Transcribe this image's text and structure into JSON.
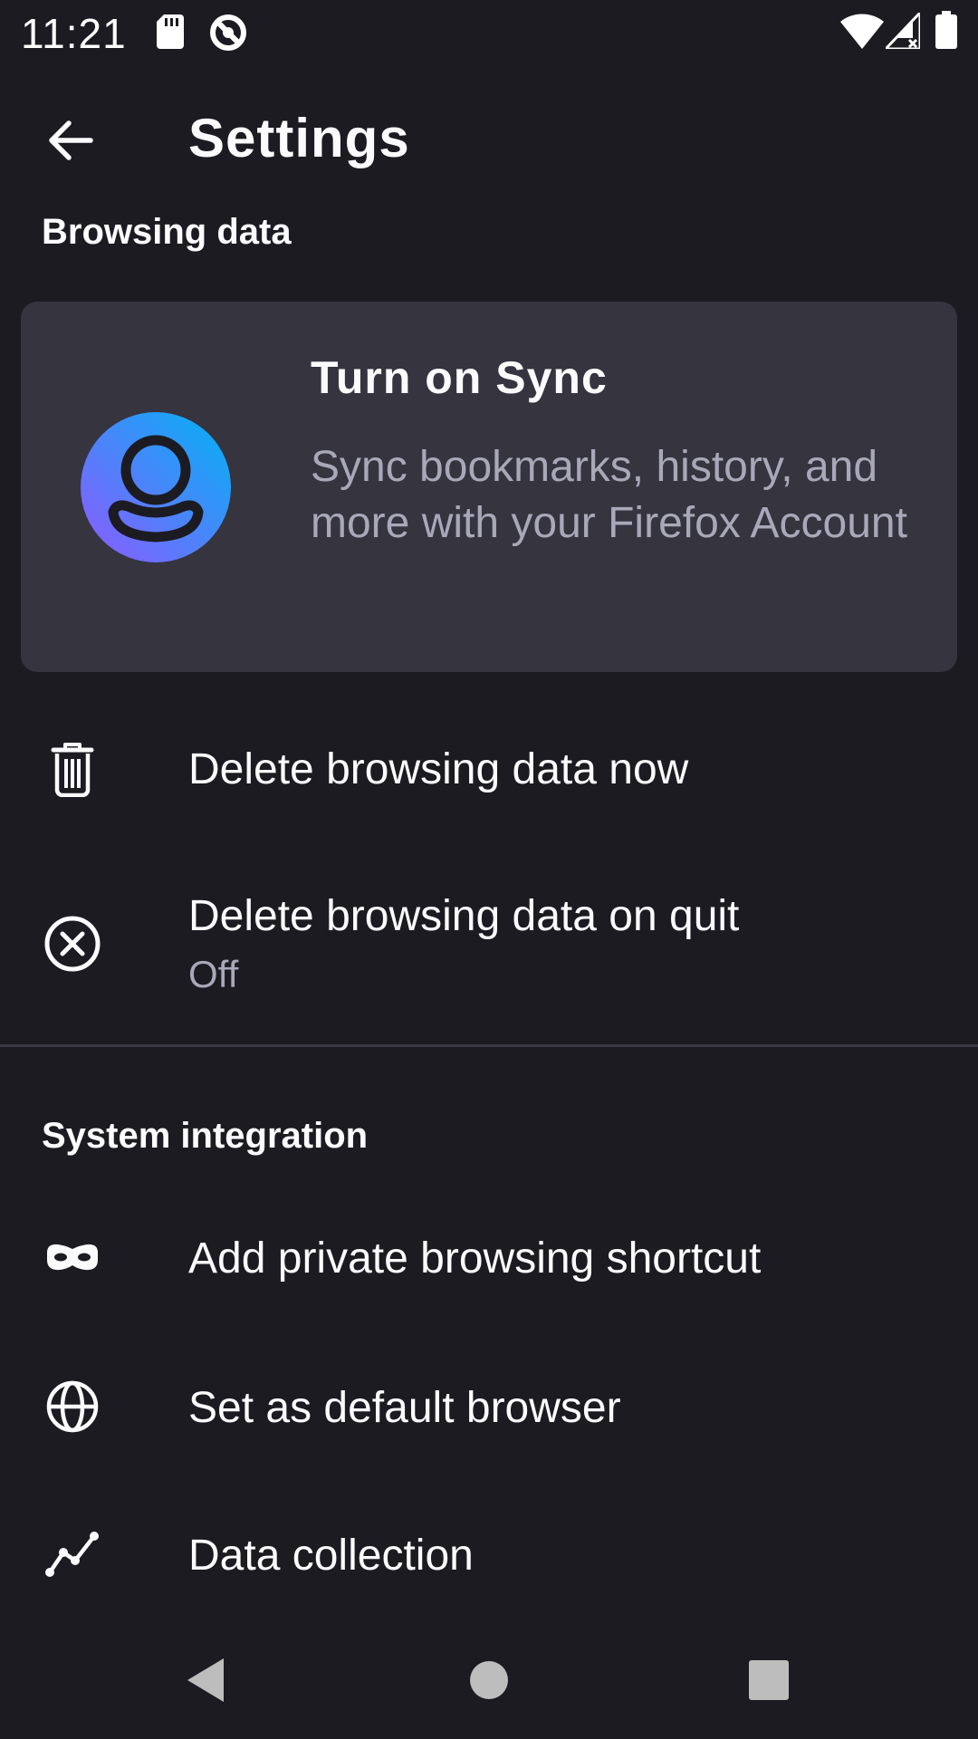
{
  "status_bar": {
    "time": "11:21",
    "left_icons": [
      "sd-card-icon",
      "do-not-disturb-icon"
    ],
    "right_icons": [
      "wifi-icon",
      "cell-signal-icon",
      "battery-icon"
    ]
  },
  "toolbar": {
    "back_icon": "arrow-left-icon",
    "title": "Settings"
  },
  "sections": {
    "browsing_data": {
      "header": "Browsing data"
    },
    "system_integration": {
      "header": "System integration"
    }
  },
  "sync_card": {
    "icon": "account-avatar-icon",
    "title": "Turn on Sync",
    "description": "Sync bookmarks, history, and more with your Firefox Account"
  },
  "prefs": {
    "delete_now": {
      "icon": "trash-icon",
      "label": "Delete browsing data now"
    },
    "delete_on_quit": {
      "icon": "close-circle-icon",
      "label": "Delete browsing data on quit",
      "summary": "Off"
    },
    "private_shortcut": {
      "icon": "private-mask-icon",
      "label": "Add private browsing shortcut"
    },
    "default_browser": {
      "icon": "globe-icon",
      "label": "Set as default browser"
    },
    "data_collection": {
      "icon": "data-chart-icon",
      "label": "Data collection"
    }
  },
  "nav_bar": {
    "back": "nav-back-icon",
    "home": "nav-home-icon",
    "recents": "nav-recents-icon"
  },
  "colors": {
    "background": "#1c1b22",
    "card": "#35343f",
    "text_primary": "#fbfbfe",
    "text_secondary": "#a9a8b9",
    "avatar_gradient_start": "#00b3f4",
    "avatar_gradient_end": "#9059ff"
  }
}
